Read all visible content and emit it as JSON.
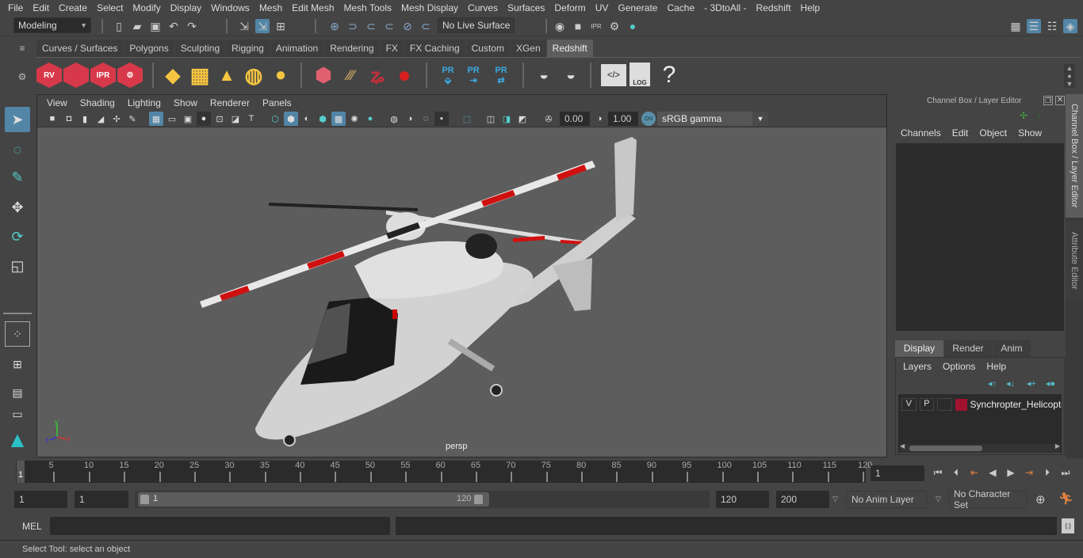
{
  "menubar": [
    "File",
    "Edit",
    "Create",
    "Select",
    "Modify",
    "Display",
    "Windows",
    "Mesh",
    "Edit Mesh",
    "Mesh Tools",
    "Mesh Display",
    "Curves",
    "Surfaces",
    "Deform",
    "UV",
    "Generate",
    "Cache",
    "- 3DtoAll -",
    "Redshift",
    "Help"
  ],
  "statusline": {
    "workspace": "Modeling",
    "live_surface": "No Live Surface"
  },
  "shelf": {
    "tabs": [
      "Curves / Surfaces",
      "Polygons",
      "Sculpting",
      "Rigging",
      "Animation",
      "Rendering",
      "FX",
      "FX Caching",
      "Custom",
      "XGen",
      "Redshift"
    ],
    "active_tab": "Redshift",
    "icons": [
      {
        "name": "redshift-render-view-icon",
        "label": "RV"
      },
      {
        "name": "redshift-batch-render-icon",
        "label": ""
      },
      {
        "name": "redshift-ipr-icon",
        "label": "IPR"
      },
      {
        "name": "redshift-render-settings-icon",
        "label": ""
      },
      {
        "name": "redshift-area-light-icon",
        "label": ""
      },
      {
        "name": "redshift-portal-light-icon",
        "label": ""
      },
      {
        "name": "redshift-ies-light-icon",
        "label": ""
      },
      {
        "name": "redshift-dome-light-icon",
        "label": ""
      },
      {
        "name": "redshift-sun-sky-icon",
        "label": ""
      },
      {
        "name": "redshift-proxy-icon",
        "label": ""
      },
      {
        "name": "redshift-hair-icon",
        "label": ""
      },
      {
        "name": "redshift-volume-icon",
        "label": ""
      },
      {
        "name": "redshift-material-ball-icon",
        "label": ""
      },
      {
        "name": "redshift-proxy-export-icon",
        "label": "PR"
      },
      {
        "name": "redshift-proxy-import-icon",
        "label": "PR"
      },
      {
        "name": "redshift-proxy-swap-icon",
        "label": "PR"
      },
      {
        "name": "redshift-bake-set-icon",
        "label": ""
      },
      {
        "name": "redshift-bake-icon",
        "label": ""
      },
      {
        "name": "redshift-script-editor-icon",
        "label": ""
      },
      {
        "name": "redshift-log-icon",
        "label": "LOG"
      },
      {
        "name": "help-icon",
        "label": "?"
      }
    ]
  },
  "viewport": {
    "menu": [
      "View",
      "Shading",
      "Lighting",
      "Show",
      "Renderer",
      "Panels"
    ],
    "exposure": "0.00",
    "gamma": "1.00",
    "color_mgmt": "ON",
    "color_space": "sRGB gamma",
    "camera": "persp",
    "axis": {
      "x": "x",
      "y": "y",
      "z": "z"
    }
  },
  "channel_box": {
    "title": "Channel Box / Layer Editor",
    "menu": [
      "Channels",
      "Edit",
      "Object",
      "Show"
    ],
    "layer_tabs": [
      "Display",
      "Render",
      "Anim"
    ],
    "active_layer_tab": "Display",
    "layer_menu": [
      "Layers",
      "Options",
      "Help"
    ],
    "layers": [
      {
        "v": "V",
        "p": "P",
        "color": "#a0122e",
        "name": "Synchropter_Helicopter"
      }
    ]
  },
  "side_tabs": [
    "Channel Box / Layer Editor",
    "Attribute Editor"
  ],
  "timeline": {
    "ticks": [
      5,
      10,
      15,
      20,
      25,
      30,
      35,
      40,
      45,
      50,
      55,
      60,
      65,
      70,
      75,
      80,
      85,
      90,
      95,
      100,
      105,
      110,
      115,
      120
    ],
    "current_frame_marker": "1",
    "current_frame": "1",
    "range_start": "1",
    "playback_start": "1",
    "slider_start": "1",
    "slider_end": "120",
    "playback_end": "120",
    "range_end": "200",
    "anim_layer": "No Anim Layer",
    "character_set": "No Character Set"
  },
  "command_line": {
    "label": "MEL",
    "value": ""
  },
  "help_line": "Select Tool: select an object"
}
